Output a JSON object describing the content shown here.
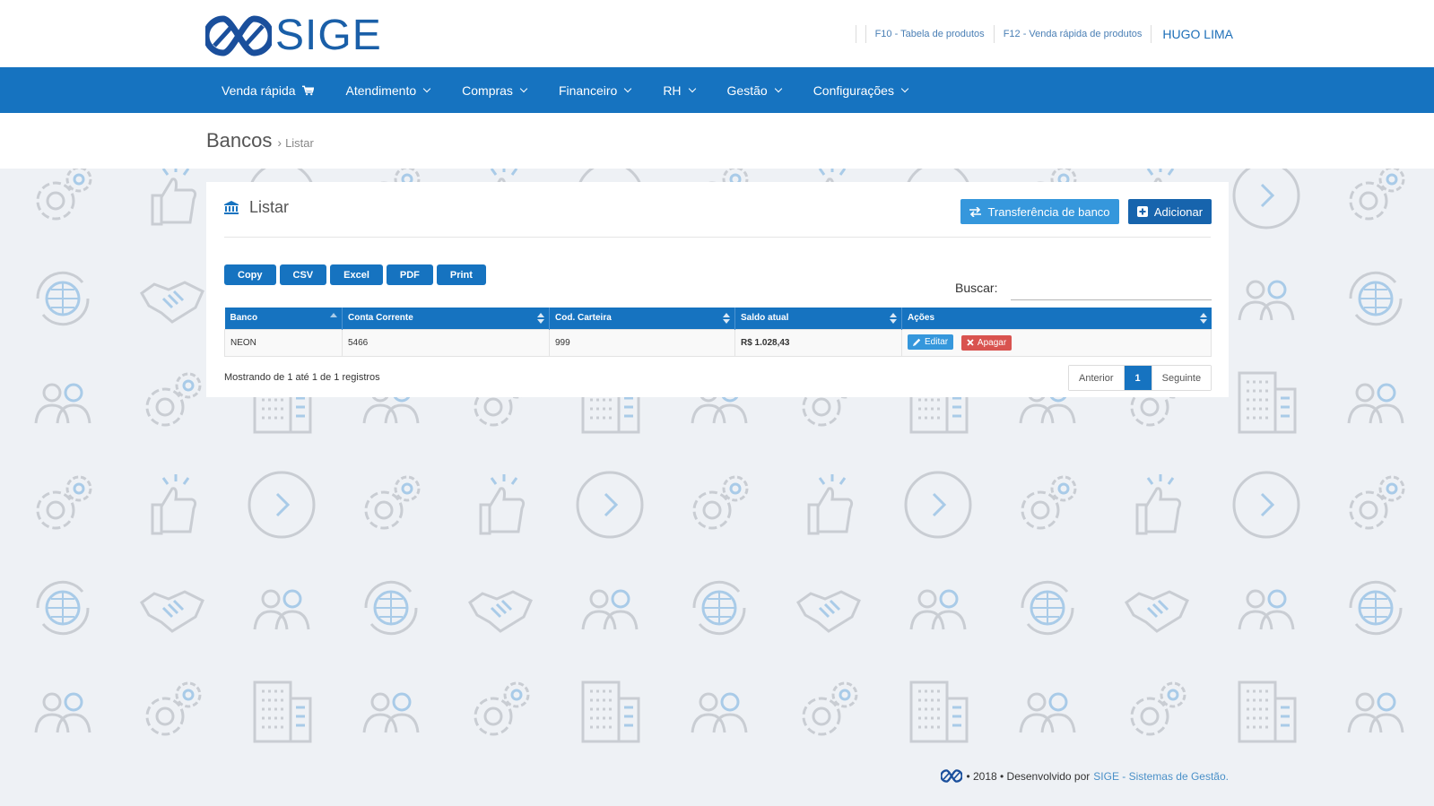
{
  "brand": {
    "name": "SIGE"
  },
  "top_links": {
    "f10": "F10 - Tabela de produtos",
    "f12": "F12 - Venda rápida de produtos",
    "user": "HUGO LIMA"
  },
  "nav": {
    "items": [
      {
        "label": "Venda rápida",
        "icon": "cart-icon"
      },
      {
        "label": "Atendimento",
        "icon": "chevron-down-icon"
      },
      {
        "label": "Compras",
        "icon": "chevron-down-icon"
      },
      {
        "label": "Financeiro",
        "icon": "chevron-down-icon"
      },
      {
        "label": "RH",
        "icon": "chevron-down-icon"
      },
      {
        "label": "Gestão",
        "icon": "chevron-down-icon"
      },
      {
        "label": "Configurações",
        "icon": "chevron-down-icon"
      }
    ]
  },
  "breadcrumb": {
    "title": "Bancos",
    "separator": "›",
    "current": "Listar"
  },
  "panel": {
    "title": "Listar",
    "title_icon": "bank-icon",
    "transfer_label": "Transferência de banco",
    "add_label": "Adicionar"
  },
  "export_buttons": [
    "Copy",
    "CSV",
    "Excel",
    "PDF",
    "Print"
  ],
  "search": {
    "label": "Buscar:",
    "value": ""
  },
  "table": {
    "columns": [
      "Banco",
      "Conta Corrente",
      "Cod. Carteira",
      "Saldo atual",
      "Ações"
    ],
    "rows": [
      {
        "banco": "NEON",
        "conta": "5466",
        "carteira": "999",
        "saldo": "R$ 1.028,43",
        "edit_label": "Editar",
        "delete_label": "Apagar"
      }
    ]
  },
  "table_info": "Mostrando de 1 até 1 de 1 registros",
  "pagination": {
    "prev": "Anterior",
    "current": "1",
    "next": "Seguinte"
  },
  "footer": {
    "text": "• 2018 • Desenvolvido por",
    "link": "SIGE - Sistemas de Gestão."
  },
  "colors": {
    "primary": "#1673c0",
    "secondary": "#3597dc",
    "danger": "#d9534f",
    "success_text": "#2a9a73",
    "background": "#eef1f5"
  }
}
